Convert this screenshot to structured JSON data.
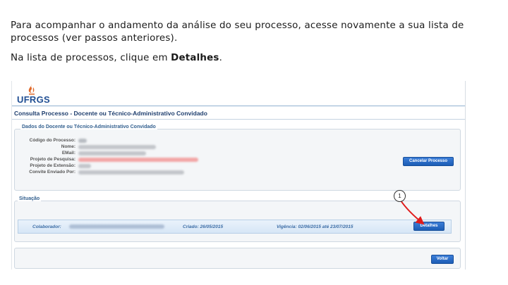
{
  "intro": {
    "paragraph1": "Para acompanhar o andamento da análise do seu processo, acesse novamente a sua lista de processos (ver passos anteriores).",
    "paragraph2_prefix": "Na lista de processos, clique em ",
    "paragraph2_bold": "Detalhes",
    "paragraph2_suffix": "."
  },
  "screenshot": {
    "logo_text": "UFRGS",
    "page_title": "Consulta Processo - Docente ou Técnico-Administrativo Convidado",
    "panel_docente": {
      "legend": "Dados do Docente ou Técnico-Administrativo Convidado",
      "labels": [
        "Código do Processo:",
        "Nome:",
        "EMail:",
        "Projeto de Pesquisa:",
        "Projeto de Extensão:",
        "Convite Enviado Por:"
      ],
      "cancel_button": "Cancelar Processo"
    },
    "panel_situacao": {
      "legend": "Situação",
      "colaborador_label": "Colaborador:",
      "criado": "Criado: 26/05/2015",
      "vigencia": "Vigência: 02/06/2015 até 23/07/2015",
      "details_button": "Detalhes"
    },
    "back_button": "Voltar",
    "annotation_number": "1"
  },
  "colors": {
    "accent": "#1c5db5",
    "logo": "#1f4e93",
    "flame": "#e06a2b",
    "arrow": "#e01b1b"
  }
}
